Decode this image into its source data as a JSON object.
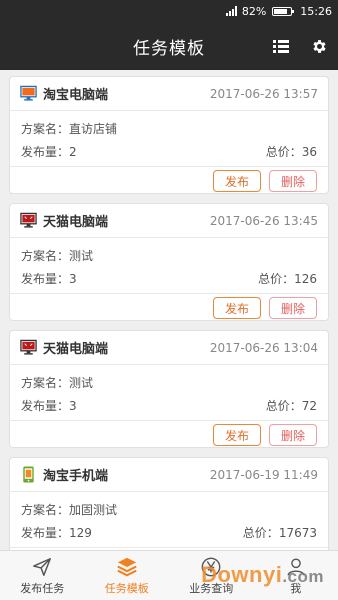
{
  "status_bar": {
    "battery": "82%",
    "time": "15:26",
    "battery_level": 0.82
  },
  "header": {
    "title": "任务模板"
  },
  "labels": {
    "plan": "方案名：",
    "qty": "发布量：",
    "total": "总价：",
    "publish": "发布",
    "delete": "删除"
  },
  "cards": [
    {
      "platform": "淘宝电脑端",
      "icon": "taobao-pc-icon",
      "time": "2017-06-26 13:57",
      "plan": "直访店铺",
      "qty": "2",
      "total": "36"
    },
    {
      "platform": "天猫电脑端",
      "icon": "tmall-pc-icon",
      "time": "2017-06-26 13:45",
      "plan": "测试",
      "qty": "3",
      "total": "126"
    },
    {
      "platform": "天猫电脑端",
      "icon": "tmall-pc-icon",
      "time": "2017-06-26 13:04",
      "plan": "测试",
      "qty": "3",
      "total": "72"
    },
    {
      "platform": "淘宝手机端",
      "icon": "taobao-mobile-icon",
      "time": "2017-06-19 11:49",
      "plan": "加固测试",
      "qty": "129",
      "total": "17673"
    }
  ],
  "tabs": [
    {
      "label": "发布任务",
      "icon": "send-icon"
    },
    {
      "label": "任务模板",
      "icon": "layers-icon",
      "active": true
    },
    {
      "label": "业务查询",
      "icon": "yen-icon"
    },
    {
      "label": "我",
      "icon": "user-icon"
    }
  ],
  "watermark": {
    "main": "Downyi",
    "suffix": ".com"
  },
  "colors": {
    "header": "#2a2a2a",
    "accent": "#f08020",
    "delete": "#e06060"
  }
}
